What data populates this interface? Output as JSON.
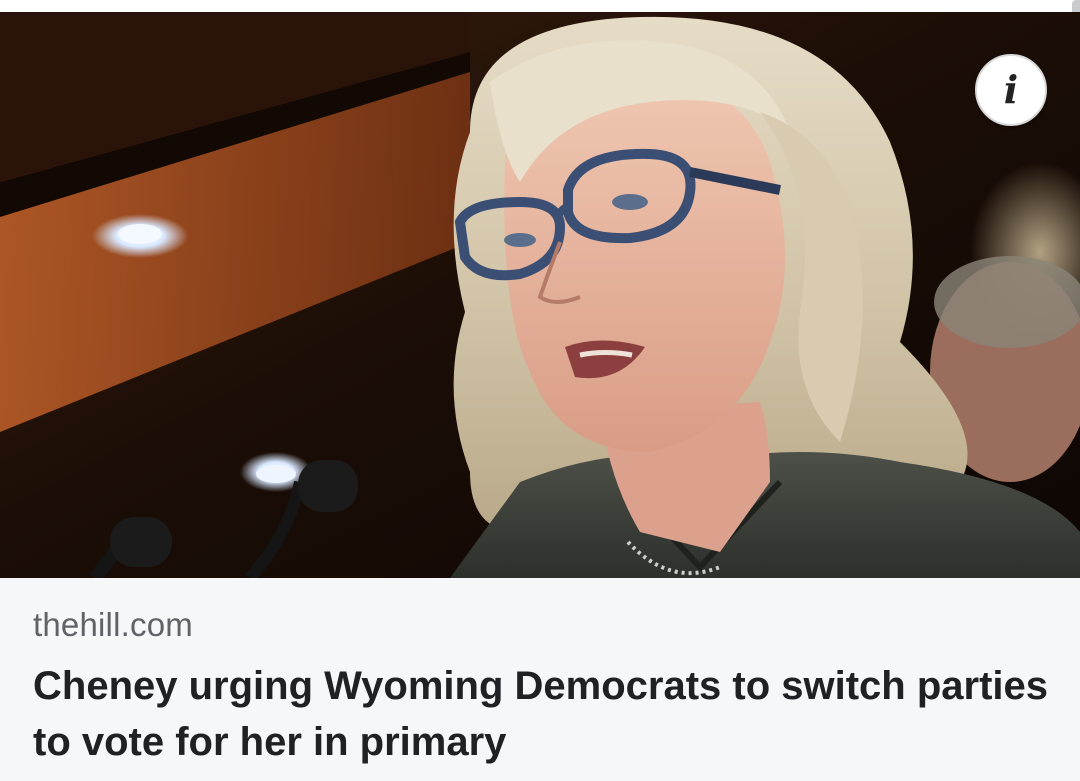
{
  "article": {
    "source": "thehill.com",
    "headline": "Cheney urging Wyoming Democrats to switch parties to vote for her in primary"
  },
  "icons": {
    "info": "info-icon"
  },
  "info_glyph": "i",
  "colors": {
    "card_background": "#f6f7f9",
    "source_text": "#5f6368",
    "headline_text": "#202124",
    "info_button_bg": "#ffffff"
  }
}
